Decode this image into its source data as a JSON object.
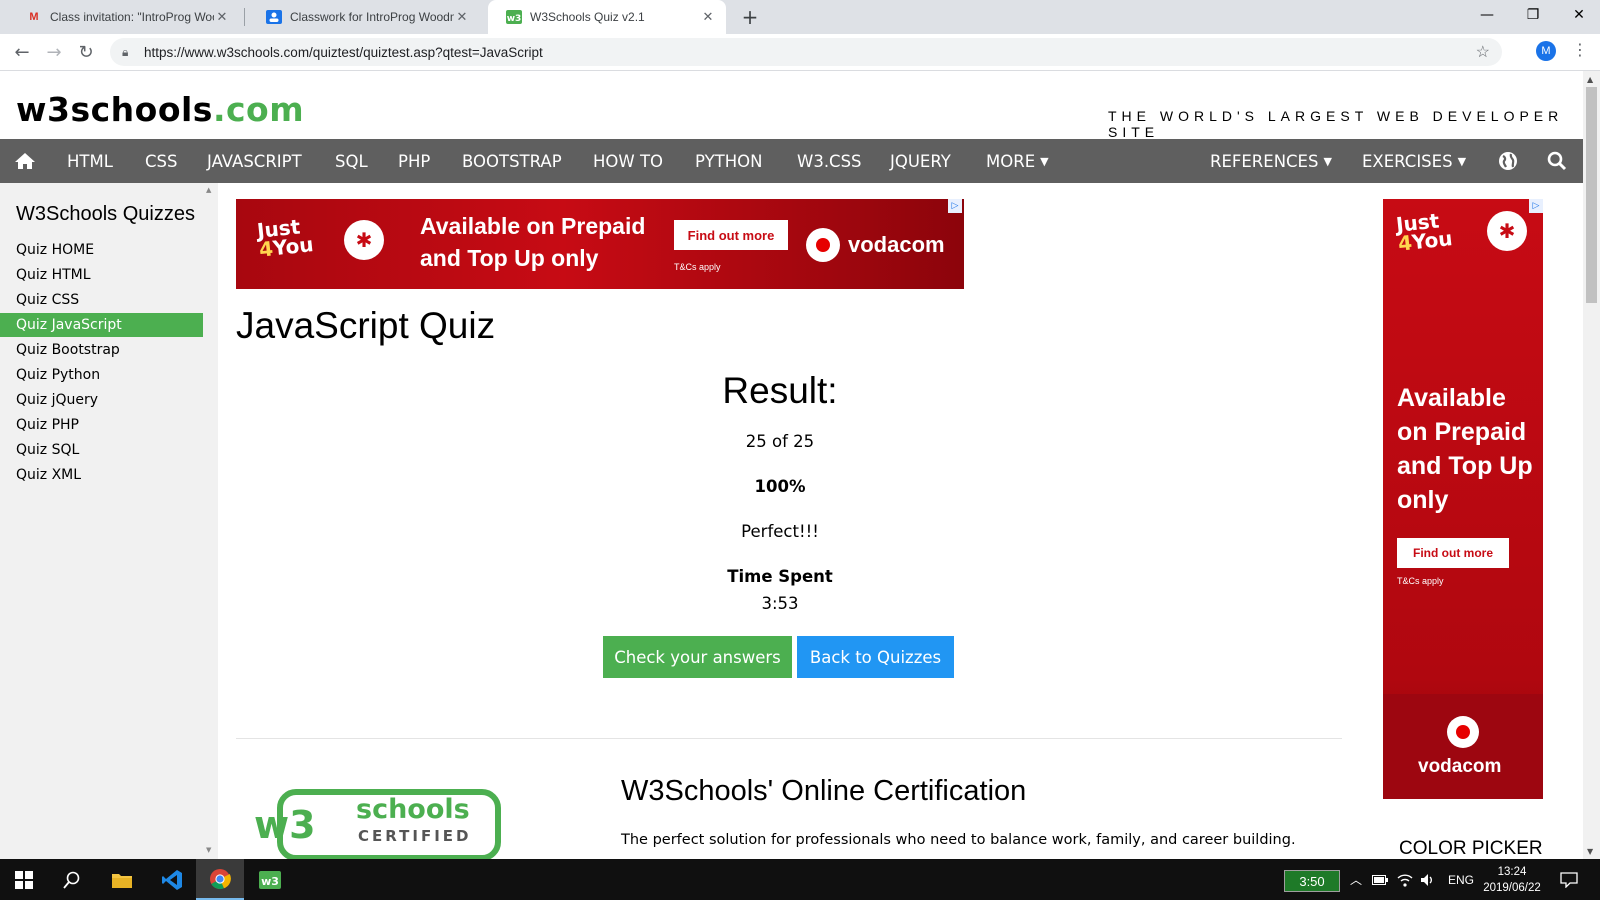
{
  "browser": {
    "tabs": [
      {
        "title": "Class invitation: \"IntroProg Wood",
        "favicon": "M"
      },
      {
        "title": "Classwork for IntroProg Woodme",
        "favicon": "classroom"
      },
      {
        "title": "W3Schools Quiz v2.1",
        "favicon": "w3"
      }
    ],
    "new_tab": "+",
    "url": "https://www.w3schools.com/quiztest/quiztest.asp?qtest=JavaScript",
    "profile_initial": "M"
  },
  "site": {
    "logo_main": "w3schools",
    "logo_tld": ".com",
    "tagline": "THE WORLD'S LARGEST WEB DEVELOPER SITE",
    "accent_color": "#4caf50",
    "nav": {
      "items": [
        "HTML",
        "CSS",
        "JAVASCRIPT",
        "SQL",
        "PHP",
        "BOOTSTRAP",
        "HOW TO",
        "PYTHON",
        "W3.CSS",
        "JQUERY",
        "MORE"
      ],
      "references": "REFERENCES",
      "exercises": "EXERCISES"
    }
  },
  "sidebar": {
    "title": "W3Schools Quizzes",
    "items": [
      "Quiz HOME",
      "Quiz HTML",
      "Quiz CSS",
      "Quiz JavaScript",
      "Quiz Bootstrap",
      "Quiz Python",
      "Quiz jQuery",
      "Quiz PHP",
      "Quiz SQL",
      "Quiz XML"
    ],
    "active_item": "Quiz JavaScript"
  },
  "ad_banner": {
    "logo_line1": "Just",
    "logo_line2a": "4",
    "logo_line2b": "You",
    "line1": "Available on Prepaid",
    "line2": "and Top Up only",
    "button": "Find out more",
    "terms": "T&Cs apply",
    "brand": "vodacom"
  },
  "main": {
    "title": "JavaScript Quiz",
    "result_title": "Result:",
    "score": "25 of 25",
    "percent": "100%",
    "message": "Perfect!!!",
    "time_label": "Time Spent",
    "time_value": "3:53",
    "check_button": "Check your answers",
    "back_button": "Back to Quizzes"
  },
  "certification": {
    "logo_word": "schools",
    "logo_sub": "CERTIFIED",
    "title": "W3Schools' Online Certification",
    "text": "The perfect solution for professionals who need to balance work, family, and career building."
  },
  "ad_side": {
    "logo_line1": "Just",
    "logo_line2a": "4",
    "logo_line2b": "You",
    "line1": "Available",
    "line2": "on Prepaid",
    "line3": "and Top Up",
    "line4": "only",
    "button": "Find out more",
    "terms": "T&Cs apply",
    "brand": "vodacom"
  },
  "color_picker": "COLOR PICKER",
  "taskbar": {
    "timer": "3:50",
    "language": "ENG",
    "time": "13:24",
    "date": "2019/06/22"
  }
}
